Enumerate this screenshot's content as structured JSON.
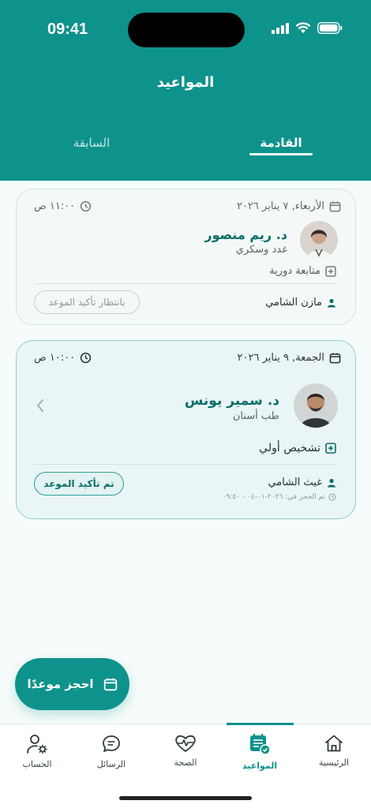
{
  "status_bar": {
    "time": "09:41"
  },
  "header": {
    "title": "المواعيد",
    "tabs": [
      {
        "label": "القادمة",
        "active": true
      },
      {
        "label": "السابقة",
        "active": false
      }
    ]
  },
  "appointments": [
    {
      "date": "الأربعاء, ٧ يناير ٢٠٢٦",
      "time": "١١:٠٠ ص",
      "doctor": "د. ريم منصور",
      "specialty": "غدد وسكري",
      "visit_type": "متابعة دورية",
      "patient": "مازن الشامي",
      "status": "بانتظار تأكيد الموعد"
    },
    {
      "date": "الجمعة, ٩ يناير ٢٠٢٦",
      "time": "١٠:٠٠ ص",
      "doctor": "د. سمير يونس",
      "specialty": "طب أسنان",
      "visit_type": "تشخيص أولي",
      "patient": "غيث الشامي",
      "booked_at": "تم الحجز في: ٢٠٢٦-٠١-٠٤ - ٠٩:٥٠",
      "status": "تم تأكيد الموعد"
    }
  ],
  "fab": {
    "label": "احجز موعدًا"
  },
  "tabbar": [
    {
      "label": "الرئيسية",
      "icon": "home-icon"
    },
    {
      "label": "المواعيد",
      "icon": "calendar-icon",
      "active": true
    },
    {
      "label": "الصحة",
      "icon": "heart-pulse-icon"
    },
    {
      "label": "الرسائل",
      "icon": "chat-icon"
    },
    {
      "label": "الحساب",
      "icon": "user-gear-icon"
    }
  ],
  "colors": {
    "primary": "#0e928c",
    "primary_dark": "#0a6e69",
    "background": "#f6fcfb"
  }
}
